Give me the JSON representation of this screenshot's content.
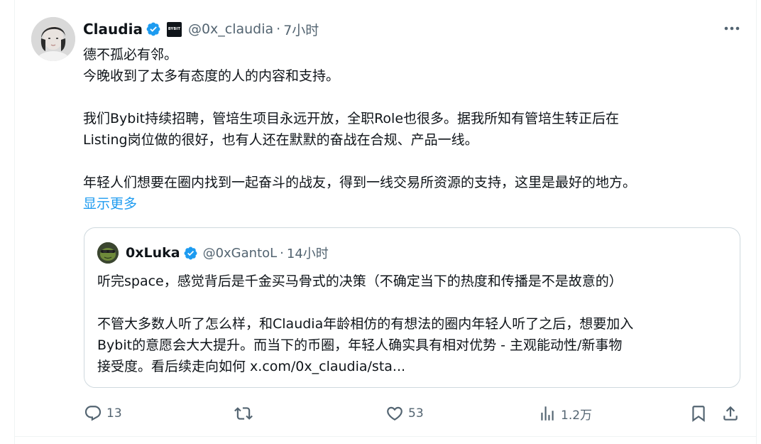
{
  "author": {
    "name": "Claudia",
    "handle": "@0x_claudia",
    "separator": "·",
    "time": "7小时",
    "affiliate_badge_text": "BYBIT",
    "verified_icon": "verified-badge-icon"
  },
  "tweet": {
    "lines": [
      "德不孤必有邻。",
      "今晚收到了太多有态度的人的内容和支持。",
      "",
      "我们Bybit持续招聘，管培生项目永远开放，全职Role也很多。据我所知有管培生转正后在",
      "Listing岗位做的很好，也有人还在默默的奋战在合规、产品一线。",
      "",
      "年轻人们想要在圈内找到一起奋斗的战友，得到一线交易所资源的支持，这里是最好的地方。"
    ],
    "show_more": "显示更多"
  },
  "quote": {
    "name": "0xLuka",
    "handle": "@0xGantoL",
    "separator": "·",
    "time": "14小时",
    "lines": [
      "听完space，感觉背后是千金买马骨式的决策（不确定当下的热度和传播是不是故意的）",
      "",
      "不管大多数人听了怎么样，和Claudia年龄相仿的有想法的圈内年轻人听了之后，想要加入",
      "Bybit的意愿会大大提升。而当下的币圈，年轻人确实具有相对优势 - 主观能动性/新事物",
      "接受度。看后续走向如何 x.com/0x_claudia/sta..."
    ]
  },
  "actions": {
    "replies": "13",
    "retweets": "",
    "likes": "53",
    "views": "1.2万",
    "icons": [
      "reply-icon",
      "retweet-icon",
      "like-icon",
      "views-icon",
      "bookmark-icon",
      "share-icon"
    ]
  },
  "colors": {
    "text": "#0f1419",
    "secondary": "#536471",
    "accent": "#1d9bf0",
    "border": "#cfd9de"
  }
}
